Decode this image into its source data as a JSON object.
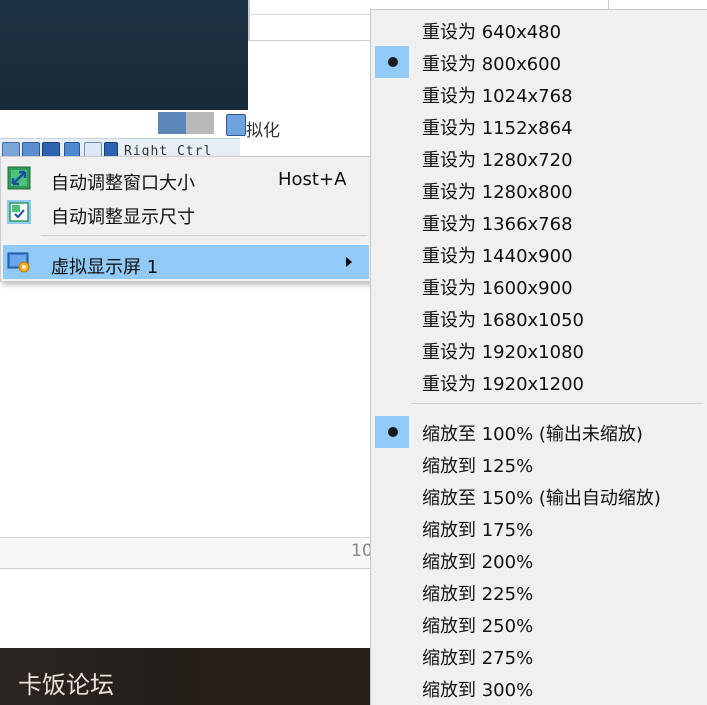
{
  "background": {
    "status_label": "拟化",
    "host_key_label": "Right Ctrl",
    "page_number": "10",
    "footer_text": "卡饭论坛"
  },
  "context_menu": {
    "items": [
      {
        "label": "自动调整窗口大小",
        "shortcut": "Host+A",
        "icon": "resize-window-icon"
      },
      {
        "label": "自动调整显示尺寸",
        "shortcut": "",
        "icon": "auto-resize-display-icon"
      },
      {
        "label": "虚拟显示屏 1",
        "shortcut": "",
        "icon": "virtual-screen-icon",
        "has_submenu": true,
        "highlighted": true
      }
    ]
  },
  "submenu": {
    "resolutions": [
      {
        "label": "重设为 640x480",
        "selected": false
      },
      {
        "label": "重设为 800x600",
        "selected": true
      },
      {
        "label": "重设为 1024x768",
        "selected": false
      },
      {
        "label": "重设为 1152x864",
        "selected": false
      },
      {
        "label": "重设为 1280x720",
        "selected": false
      },
      {
        "label": "重设为 1280x800",
        "selected": false
      },
      {
        "label": "重设为 1366x768",
        "selected": false
      },
      {
        "label": "重设为 1440x900",
        "selected": false
      },
      {
        "label": "重设为 1600x900",
        "selected": false
      },
      {
        "label": "重设为 1680x1050",
        "selected": false
      },
      {
        "label": "重设为 1920x1080",
        "selected": false
      },
      {
        "label": "重设为 1920x1200",
        "selected": false
      }
    ],
    "scales": [
      {
        "label": "缩放至 100% (输出未缩放)",
        "selected": true
      },
      {
        "label": "缩放到 125%",
        "selected": false
      },
      {
        "label": "缩放至 150% (输出自动缩放)",
        "selected": false
      },
      {
        "label": "缩放到 175%",
        "selected": false
      },
      {
        "label": "缩放到 200%",
        "selected": false
      },
      {
        "label": "缩放到 225%",
        "selected": false
      },
      {
        "label": "缩放到 250%",
        "selected": false
      },
      {
        "label": "缩放到 275%",
        "selected": false
      },
      {
        "label": "缩放到 300%",
        "selected": false
      }
    ]
  },
  "colors": {
    "highlight": "#91c9f7",
    "menu_bg": "#f0f0f0",
    "dark_panel": "#1d3243"
  }
}
